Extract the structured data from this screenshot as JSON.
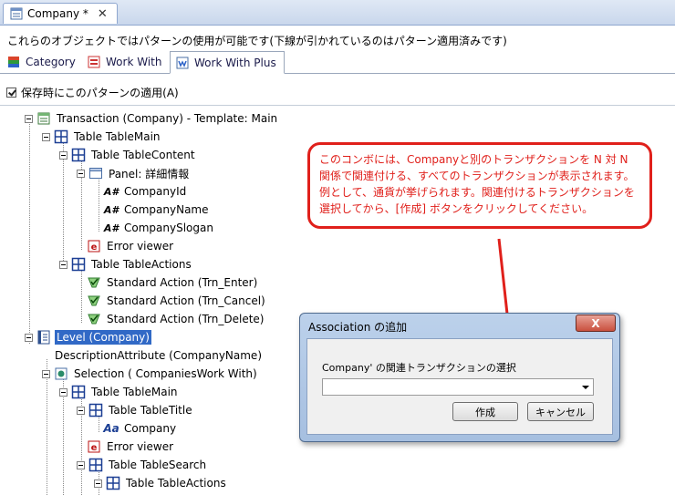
{
  "document_tab": {
    "title": "Company *",
    "close": "✕"
  },
  "description": "これらのオブジェクトではパターンの使用が可能です(下線が引かれているのはパターン適用済みです)",
  "pattern_tabs": [
    {
      "label": "Category",
      "icon": "category-icon",
      "active": false
    },
    {
      "label": "Work With",
      "icon": "work-with-icon",
      "active": false
    },
    {
      "label": "Work With Plus",
      "icon": "work-with-plus-icon",
      "active": true
    }
  ],
  "apply_on_save": {
    "label": "保存時にこのパターンの適用(A)",
    "checked": true
  },
  "tree": [
    {
      "label": "Transaction (Company) - Template: Main",
      "icon": "transaction-icon",
      "expander": true
    },
    {
      "label": "Table TableMain",
      "icon": "table-icon",
      "expander": true
    },
    {
      "label": "Table TableContent",
      "icon": "table-icon",
      "expander": true
    },
    {
      "label": "Panel: 詳細情報",
      "icon": "panel-icon",
      "expander": true
    },
    {
      "label": "CompanyId",
      "icon": "attribute-icon",
      "expander": false
    },
    {
      "label": "CompanyName",
      "icon": "attribute-icon",
      "expander": false
    },
    {
      "label": "CompanySlogan",
      "icon": "attribute-icon",
      "expander": false
    },
    {
      "label": "Error viewer",
      "icon": "error-viewer-icon",
      "expander": false
    },
    {
      "label": "Table TableActions",
      "icon": "table-icon",
      "expander": true
    },
    {
      "label": "Standard Action (Trn_Enter)",
      "icon": "action-icon",
      "expander": false
    },
    {
      "label": "Standard Action (Trn_Cancel)",
      "icon": "action-icon",
      "expander": false
    },
    {
      "label": "Standard Action (Trn_Delete)",
      "icon": "action-icon",
      "expander": false
    },
    {
      "label": "Level (Company)",
      "icon": "level-icon",
      "expander": true,
      "selected": true
    },
    {
      "label": "DescriptionAttribute (CompanyName)",
      "icon": "",
      "expander": false
    },
    {
      "label": "Selection ( CompaniesWork With)",
      "icon": "selection-icon",
      "expander": true
    },
    {
      "label": "Table TableMain",
      "icon": "table-icon",
      "expander": true
    },
    {
      "label": "Table TableTitle",
      "icon": "table-icon",
      "expander": true
    },
    {
      "label": "Company",
      "icon": "text-block-icon",
      "expander": false
    },
    {
      "label": "Error viewer",
      "icon": "error-viewer-icon",
      "expander": false
    },
    {
      "label": "Table TableSearch",
      "icon": "table-icon",
      "expander": true
    },
    {
      "label": "Table TableActions",
      "icon": "table-icon",
      "expander": true
    }
  ],
  "callout": {
    "lines": [
      "このコンボには、Companyと別のトランザクションを N 対 N",
      "関係で関連付ける、すべてのトランザクションが表示されます。",
      "例として、通貨が挙げられます。関連付けるトランザクションを",
      "選択してから、[作成] ボタンをクリックしてください。"
    ]
  },
  "dialog": {
    "title": "Association の追加",
    "close": "X",
    "prompt": "Company' の関連トランザクションの選択",
    "combo_value": "",
    "create_label": "作成",
    "cancel_label": "キャンセル"
  },
  "colors": {
    "accent": "#e0201b",
    "selection": "#3169c6",
    "dialog_frame": "#a6bfe0"
  }
}
